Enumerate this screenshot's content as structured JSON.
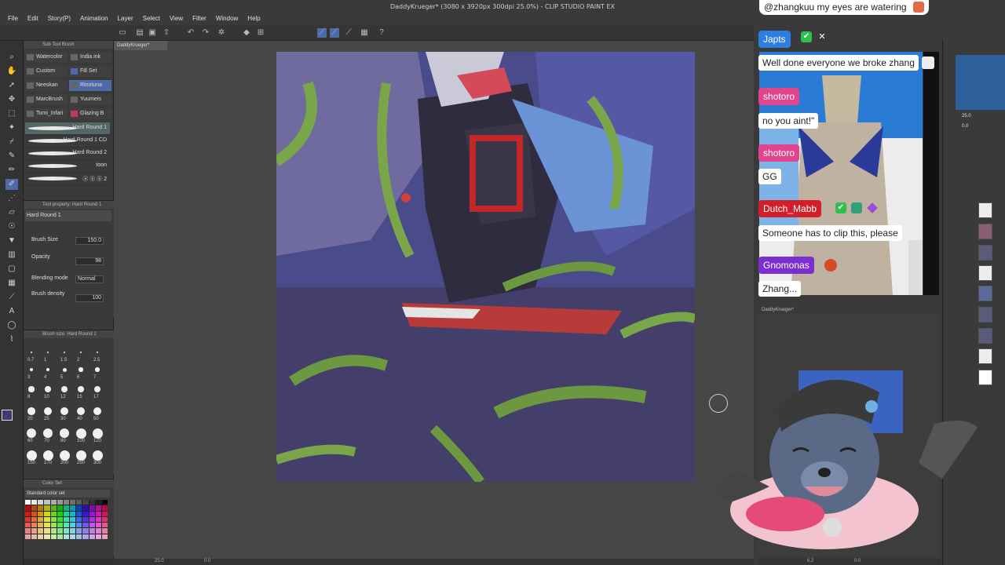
{
  "window": {
    "title": "DaddyKrueger* (3080 x 3920px 300dpi 25.0%) - CLIP STUDIO PAINT EX"
  },
  "menu": [
    "File",
    "Edit",
    "Story(P)",
    "Animation",
    "Layer",
    "Select",
    "View",
    "Filter",
    "Window",
    "Help"
  ],
  "document_tab": "DaddyKrueger*",
  "subtool": {
    "header": "Sub Tool Brush",
    "tabs": [
      {
        "label": "Watercolor"
      },
      {
        "label": "India ink"
      },
      {
        "label": "Custom"
      },
      {
        "label": "Fill Set"
      },
      {
        "label": "Neeskan"
      },
      {
        "label": "Rinotuna"
      },
      {
        "label": "MarcBrush"
      },
      {
        "label": "Yuumeis"
      },
      {
        "label": "Tomi_Infari"
      },
      {
        "label": "Glazing B"
      }
    ],
    "brushes": [
      {
        "label": "Hard Round 1"
      },
      {
        "label": "Hard Round 1 CD"
      },
      {
        "label": "Hard Round 2"
      },
      {
        "label": "toon"
      },
      {
        "label": "ⓐ ⓑ ⓑ 2"
      }
    ]
  },
  "tool_property": {
    "header": "Tool property: Hard Round 1",
    "name": "Hard Round 1",
    "brush_size_label": "Brush Size",
    "brush_size_value": "150.0",
    "opacity_label": "Opacity",
    "opacity_value": "98",
    "blending_label": "Blending mode",
    "blending_value": "Normal",
    "density_label": "Brush density",
    "density_value": "100"
  },
  "brush_size_panel": {
    "header": "Brush size: Hard Round 1",
    "sizes": [
      "0.7",
      "1",
      "1.5",
      "2",
      "2.5",
      "3",
      "4",
      "5",
      "6",
      "7",
      "8",
      "10",
      "12",
      "15",
      "17",
      "20",
      "25",
      "30",
      "40",
      "50",
      "60",
      "70",
      "80",
      "100",
      "120",
      "150",
      "170",
      "200",
      "250",
      "300"
    ]
  },
  "color_set": {
    "header": "Color Set",
    "set_name": "Standard color set"
  },
  "canvas_status": {
    "zoom": "25.0",
    "angle": "0.0"
  },
  "chat": {
    "pinned": "@zhangkuu my eyes are watering",
    "entries": [
      {
        "type": "name",
        "text": "Japts",
        "color": "#2f7de0"
      },
      {
        "type": "msg",
        "text": "Well done everyone we broke zhang"
      },
      {
        "type": "name",
        "text": "shotoro",
        "color": "#e0458e"
      },
      {
        "type": "msg",
        "text": "no you aint!\""
      },
      {
        "type": "name",
        "text": "shotoro",
        "color": "#e0458e"
      },
      {
        "type": "msg",
        "text": "GG"
      },
      {
        "type": "name",
        "text": "Dutch_Mabb",
        "color": "#d21f2a"
      },
      {
        "type": "msg",
        "text": "Someone has to clip this, please"
      },
      {
        "type": "name",
        "text": "Gnomonas",
        "color": "#7b2fd0"
      },
      {
        "type": "msg",
        "text": "Zhang..."
      }
    ]
  },
  "preview_panel": {
    "doc": "DaddyKrueger*",
    "zoom": "25.0",
    "angle": "0.0"
  },
  "right_status": {
    "zoom": "6.2",
    "angle": "0.0"
  },
  "colors": {
    "accent": "#4f6aa8",
    "main_color": "#3f3b6e"
  }
}
